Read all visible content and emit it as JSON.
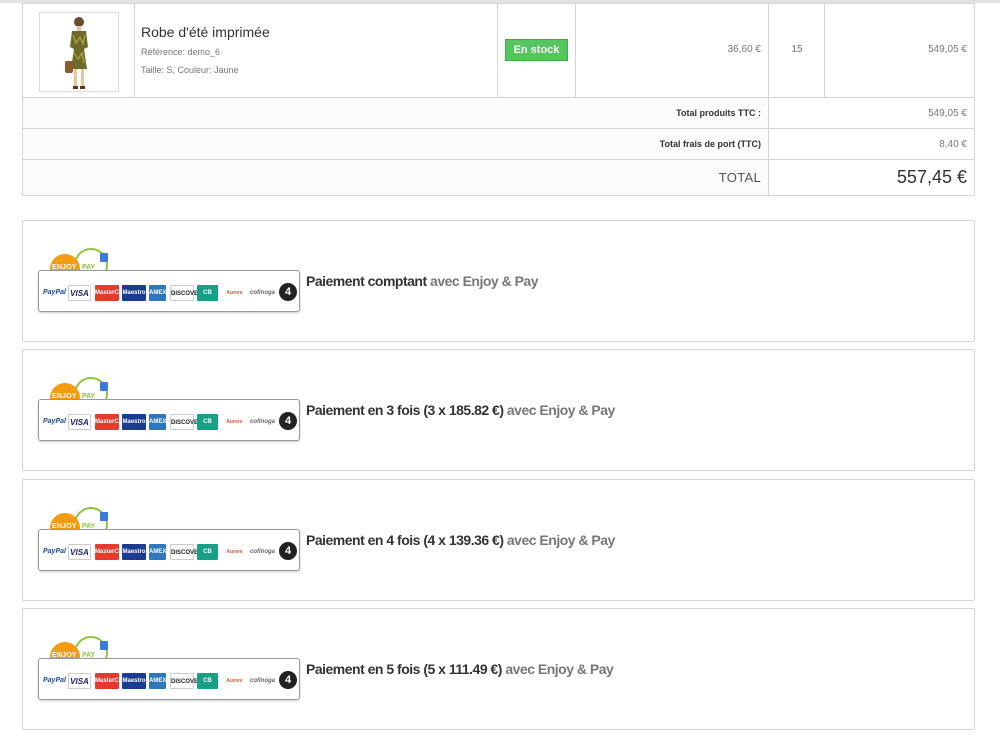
{
  "product": {
    "name": "Robe d'été imprimée",
    "reference": "Référence: demo_6",
    "attributes": "Taille: S, Couleur: Jaune",
    "stock": "En stock",
    "unit_price": "36,60 €",
    "quantity": "15",
    "total": "549,05 €"
  },
  "summary": {
    "products_label": "Total produits TTC :",
    "products_value": "549,05 €",
    "shipping_label": "Total frais de port (TTC)",
    "shipping_value": "8,40 €",
    "total_label": "TOTAL",
    "total_value": "557,45 €"
  },
  "logo": {
    "enjoy": "ENJOY",
    "pay": "PAY",
    "cards": {
      "paypal": "PayPal",
      "visa": "VISA",
      "mastercard": "MasterCard",
      "maestro": "Maestro",
      "amex": "AMEX",
      "discover": "DISCOVER",
      "cb": "CB",
      "aurore": "Aurore",
      "cofinoga": "cofinoga",
      "four": "4"
    }
  },
  "payment_options": [
    {
      "main": "Paiement comptant",
      "suffix": " avec Enjoy & Pay"
    },
    {
      "main": "Paiement en 3 fois (3 x 185.82 €)",
      "suffix": " avec Enjoy & Pay"
    },
    {
      "main": "Paiement en 4 fois (4 x 139.36 €)",
      "suffix": " avec Enjoy & Pay"
    },
    {
      "main": "Paiement en 5 fois (5 x 111.49 €)",
      "suffix": " avec Enjoy & Pay"
    }
  ],
  "colors": {
    "stock_green": "#55c65e",
    "enjoy_orange": "#f39c12",
    "pay_green": "#8cc63f"
  }
}
